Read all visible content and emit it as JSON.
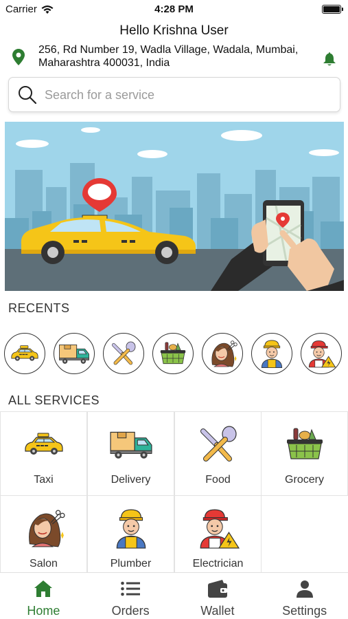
{
  "status_bar": {
    "carrier": "Carrier",
    "time": "4:28 PM"
  },
  "header": {
    "greeting": "Hello Krishna User",
    "address_line1": "256, Rd Number 19, Wadla Village, Wadala, Mumbai,",
    "address_line2": "Maharashtra 400031, India"
  },
  "search": {
    "placeholder": "Search for a service"
  },
  "sections": {
    "recents": "RECENTS",
    "all_services": "ALL SERVICES"
  },
  "recents": [
    {
      "icon": "taxi-icon"
    },
    {
      "icon": "delivery-truck-icon"
    },
    {
      "icon": "food-utensils-icon"
    },
    {
      "icon": "grocery-basket-icon"
    },
    {
      "icon": "salon-icon"
    },
    {
      "icon": "plumber-icon"
    },
    {
      "icon": "electrician-icon"
    }
  ],
  "services": [
    {
      "label": "Taxi",
      "icon": "taxi-icon"
    },
    {
      "label": "Delivery",
      "icon": "delivery-truck-icon"
    },
    {
      "label": "Food",
      "icon": "food-utensils-icon"
    },
    {
      "label": "Grocery",
      "icon": "grocery-basket-icon"
    },
    {
      "label": "Salon",
      "icon": "salon-icon"
    },
    {
      "label": "Plumber",
      "icon": "plumber-icon"
    },
    {
      "label": "Electrician",
      "icon": "electrician-icon"
    }
  ],
  "tabs": [
    {
      "label": "Home",
      "icon": "home-icon",
      "active": true
    },
    {
      "label": "Orders",
      "icon": "list-icon",
      "active": false
    },
    {
      "label": "Wallet",
      "icon": "wallet-icon",
      "active": false
    },
    {
      "label": "Settings",
      "icon": "person-icon",
      "active": false
    }
  ],
  "colors": {
    "accent": "#2e7d32",
    "taxi_yellow": "#f5c518",
    "sky": "#9fd5ea"
  }
}
